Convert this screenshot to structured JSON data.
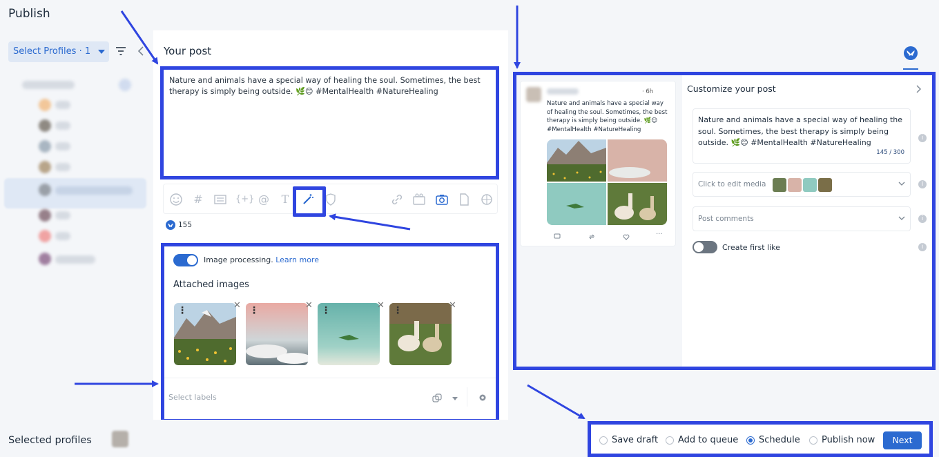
{
  "header": {
    "title": "Publish"
  },
  "sidebar": {
    "select_profiles_label": "Select Profiles · 1"
  },
  "composer": {
    "title": "Your post",
    "text": "Nature and animals have a special way of healing the soul. Sometimes, the best therapy is simply being outside. 🌿😊 #MentalHealth #NatureHealing",
    "char_count": "155"
  },
  "images": {
    "processing_label": "Image processing.",
    "learn_more": "Learn more",
    "attached_title": "Attached images",
    "labels_placeholder": "Select labels"
  },
  "preview": {
    "time": "· 6h",
    "text": "Nature and animals have a special way of healing the soul. Sometimes, the best therapy is simply being outside. 🌿😊 #MentalHealth #NatureHealing"
  },
  "customize": {
    "title": "Customize your post",
    "text": "Nature and animals have a special way of healing the soul. Sometimes, the best therapy is simply being outside. 🌿😊 #MentalHealth #NatureHealing",
    "counter": "145 / 300",
    "media_label": "Click to edit media",
    "comments_label": "Post comments",
    "first_like_label": "Create first like"
  },
  "footer": {
    "selected_profiles": "Selected profiles",
    "options": [
      "Save draft",
      "Add to queue",
      "Schedule",
      "Publish now"
    ],
    "selected_option": "Schedule",
    "next": "Next"
  },
  "colors": {
    "accent": "#2b6ad0",
    "highlight": "#2f45e0",
    "toggle_on": "#2b6ad0",
    "toggle_off": "#6b7580"
  }
}
